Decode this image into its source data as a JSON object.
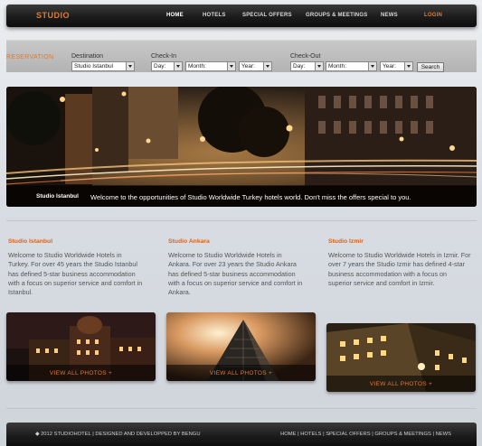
{
  "nav": {
    "logo": "STUDIO",
    "items": [
      {
        "label": "HOME"
      },
      {
        "label": "HOTELS"
      },
      {
        "label": "SPECIAL OFFERS"
      },
      {
        "label": "GROUPS & MEETINGS"
      },
      {
        "label": "NEWS"
      },
      {
        "label": "LOGIN"
      }
    ]
  },
  "reservation": {
    "title": "RESERVATION",
    "destination_label": "Destination",
    "destination_value": "Studio Istanbul",
    "checkin_label": "Check-In",
    "checkout_label": "Check-Out",
    "day_placeholder": "Day:",
    "month_placeholder": "Month:",
    "year_placeholder": "Year:",
    "search_label": "Search"
  },
  "hero": {
    "city": "Studio Istanbul",
    "text": "Welcome to the opportunities of Studio Worldwide Turkey hotels world. Don't miss the offers special to you."
  },
  "hotels": [
    {
      "title": "Studio Istanbul",
      "text": "Welcome to Studio Worldwide Hotels in Turkey. For over 45 years the Studio Istanbul has defined 5-star business accommodation with a focus on superior service and comfort in Istanbul.",
      "photos_link": "VIEW ALL PHOTOS +"
    },
    {
      "title": "Studio Ankara",
      "text": "Welcome to Studio Worldwide Hotels in Ankara. For over 23 years the Studio Ankara has defined 5-star business accommodation with a focus on superior service and comfort in Ankara.",
      "photos_link": "VIEW ALL PHOTOS +"
    },
    {
      "title": "Studio Izmir",
      "text": "Welcome to Studio Worldwide Hotels in Izmir. For over 7 years the Studio Izmir has defined 4-star business accommodation with a focus on superior service and comfort in Izmir.",
      "photos_link": "VIEW ALL PHOTOS +"
    }
  ],
  "footer": {
    "copyright": "◆ 2012 STUDIOHOTEL | DESIGNED AND DEVELOPPED BY BENGU",
    "links": [
      "HOME",
      "HOTELS",
      "SPECIAL OFFERS",
      "GROUPS & MEETINGS",
      "NEWS"
    ]
  },
  "colors": {
    "accent": "#e07a2e",
    "header_bg": "#1b1b1b",
    "reservation_bg": "#bdbdbd"
  }
}
